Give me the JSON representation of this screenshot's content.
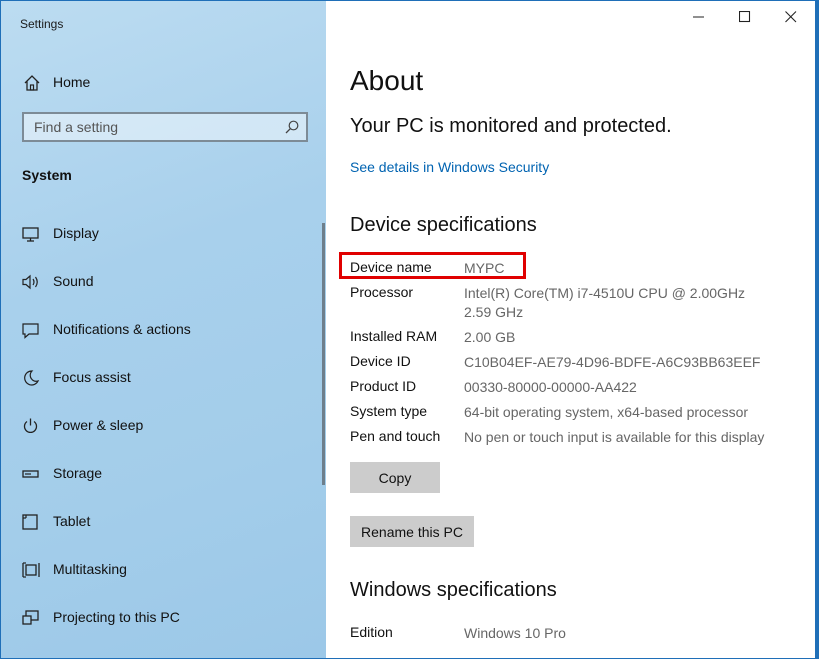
{
  "app": {
    "title": "Settings"
  },
  "sidebar": {
    "home_label": "Home",
    "search_placeholder": "Find a setting",
    "section_label": "System",
    "items": [
      {
        "label": "Display",
        "icon": "display-icon"
      },
      {
        "label": "Sound",
        "icon": "sound-icon"
      },
      {
        "label": "Notifications & actions",
        "icon": "notifications-icon"
      },
      {
        "label": "Focus assist",
        "icon": "focus-assist-icon"
      },
      {
        "label": "Power & sleep",
        "icon": "power-icon"
      },
      {
        "label": "Storage",
        "icon": "storage-icon"
      },
      {
        "label": "Tablet",
        "icon": "tablet-icon"
      },
      {
        "label": "Multitasking",
        "icon": "multitasking-icon"
      },
      {
        "label": "Projecting to this PC",
        "icon": "projecting-icon"
      }
    ]
  },
  "main": {
    "title": "About",
    "protection_status": "Your PC is monitored and protected.",
    "security_link": "See details in Windows Security",
    "device_specs_heading": "Device specifications",
    "specs": [
      {
        "key": "Device name",
        "value": "MYPC"
      },
      {
        "key": "Processor",
        "value": "Intel(R) Core(TM) i7-4510U CPU @ 2.00GHz   2.59 GHz"
      },
      {
        "key": "Installed RAM",
        "value": "2.00 GB"
      },
      {
        "key": "Device ID",
        "value": "C10B04EF-AE79-4D96-BDFE-A6C93BB63EEF"
      },
      {
        "key": "Product ID",
        "value": "00330-80000-00000-AA422"
      },
      {
        "key": "System type",
        "value": "64-bit operating system, x64-based processor"
      },
      {
        "key": "Pen and touch",
        "value": "No pen or touch input is available for this display"
      }
    ],
    "copy_button": "Copy",
    "rename_button": "Rename this PC",
    "windows_specs_heading": "Windows specifications",
    "windows_specs": [
      {
        "key": "Edition",
        "value": "Windows 10 Pro"
      }
    ]
  },
  "colors": {
    "accent_link": "#0063b1",
    "highlight": "#e00000",
    "button_bg": "#cccccc"
  }
}
